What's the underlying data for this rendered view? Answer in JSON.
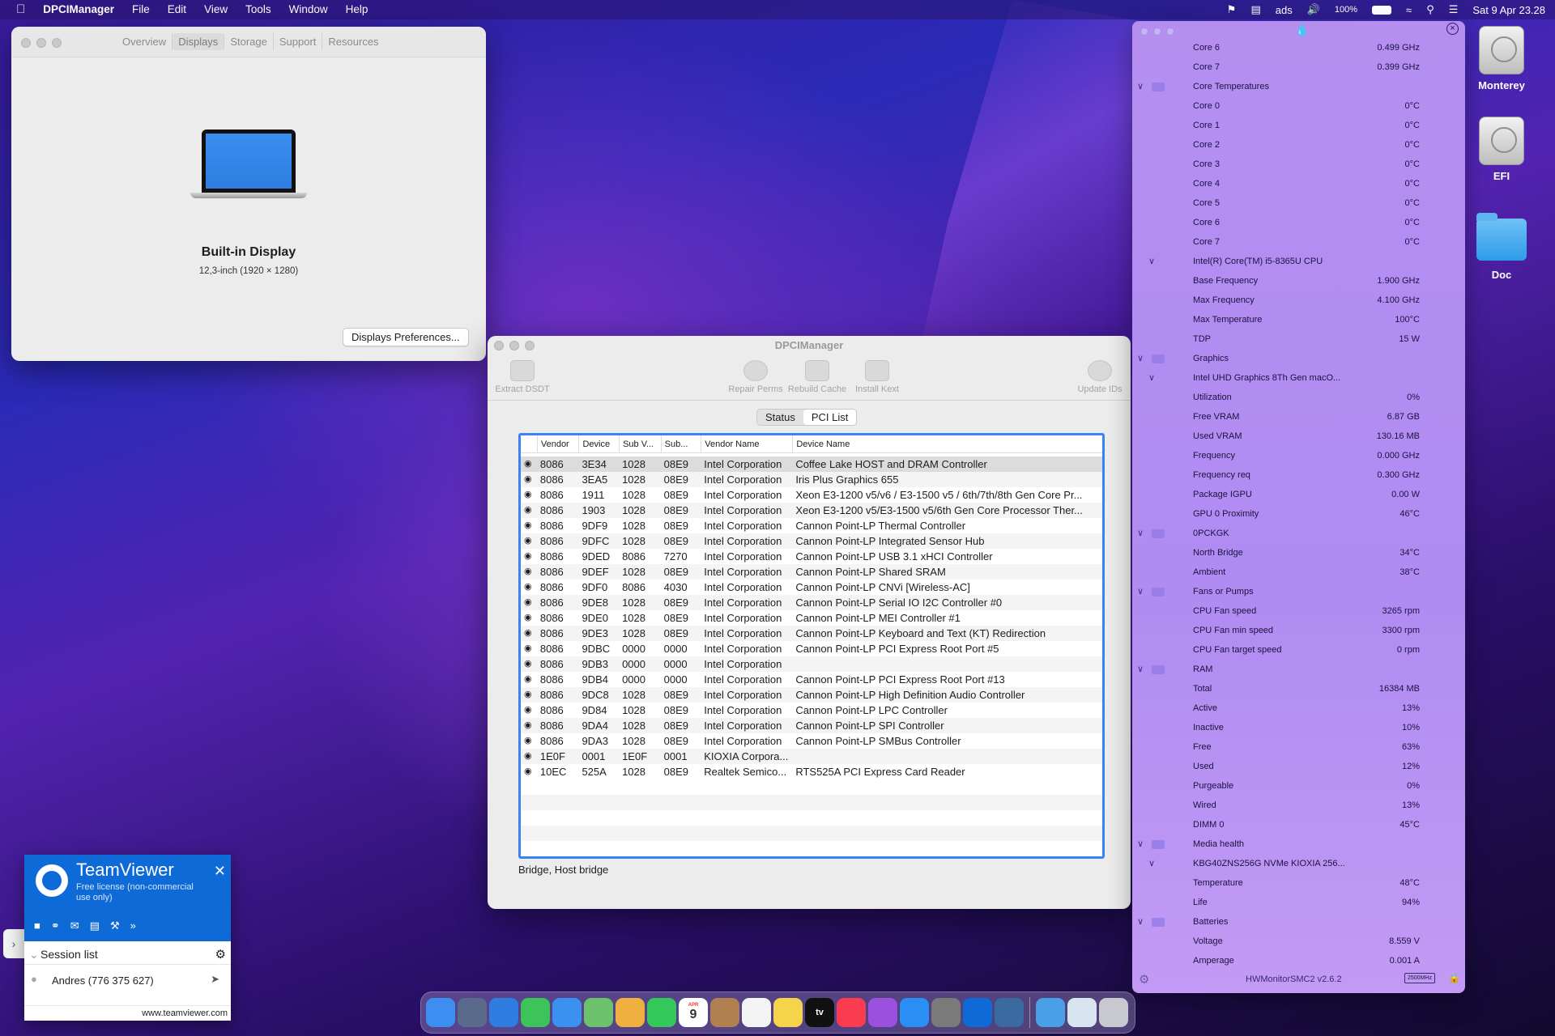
{
  "menubar": {
    "app": "DPCIManager",
    "items": [
      "File",
      "Edit",
      "View",
      "Tools",
      "Window",
      "Help"
    ],
    "status": [
      "ads",
      "100%",
      "Sat 9 Apr  23.28"
    ]
  },
  "about": {
    "tabs": [
      "Overview",
      "Displays",
      "Storage",
      "Support",
      "Resources"
    ],
    "active_tab": "Displays",
    "display_name": "Built-in Display",
    "display_spec": "12,3-inch (1920 × 1280)",
    "prefs_button": "Displays Preferences..."
  },
  "dpci": {
    "title": "DPCIManager",
    "toolbar": [
      "Extract DSDT",
      "Repair Perms",
      "Rebuild Cache",
      "Install Kext",
      "Update IDs"
    ],
    "tabs": [
      "Status",
      "PCI List"
    ],
    "active_tab": "PCI List",
    "columns": [
      "Vendor",
      "Device",
      "Sub V...",
      "Sub...",
      "Vendor Name",
      "Device Name"
    ],
    "rows": [
      [
        "8086",
        "3E34",
        "1028",
        "08E9",
        "Intel Corporation",
        "Coffee Lake HOST and DRAM Controller"
      ],
      [
        "8086",
        "3EA5",
        "1028",
        "08E9",
        "Intel Corporation",
        "Iris Plus Graphics 655"
      ],
      [
        "8086",
        "1911",
        "1028",
        "08E9",
        "Intel Corporation",
        "Xeon E3-1200 v5/v6 / E3-1500 v5 / 6th/7th/8th Gen Core Pr..."
      ],
      [
        "8086",
        "1903",
        "1028",
        "08E9",
        "Intel Corporation",
        "Xeon E3-1200 v5/E3-1500 v5/6th Gen Core Processor Ther..."
      ],
      [
        "8086",
        "9DF9",
        "1028",
        "08E9",
        "Intel Corporation",
        "Cannon Point-LP Thermal Controller"
      ],
      [
        "8086",
        "9DFC",
        "1028",
        "08E9",
        "Intel Corporation",
        "Cannon Point-LP Integrated Sensor Hub"
      ],
      [
        "8086",
        "9DED",
        "8086",
        "7270",
        "Intel Corporation",
        "Cannon Point-LP USB 3.1 xHCI Controller"
      ],
      [
        "8086",
        "9DEF",
        "1028",
        "08E9",
        "Intel Corporation",
        "Cannon Point-LP Shared SRAM"
      ],
      [
        "8086",
        "9DF0",
        "8086",
        "4030",
        "Intel Corporation",
        "Cannon Point-LP CNVi [Wireless-AC]"
      ],
      [
        "8086",
        "9DE8",
        "1028",
        "08E9",
        "Intel Corporation",
        "Cannon Point-LP Serial IO I2C Controller #0"
      ],
      [
        "8086",
        "9DE0",
        "1028",
        "08E9",
        "Intel Corporation",
        "Cannon Point-LP MEI Controller #1"
      ],
      [
        "8086",
        "9DE3",
        "1028",
        "08E9",
        "Intel Corporation",
        "Cannon Point-LP Keyboard and Text (KT) Redirection"
      ],
      [
        "8086",
        "9DBC",
        "0000",
        "0000",
        "Intel Corporation",
        "Cannon Point-LP PCI Express Root Port #5"
      ],
      [
        "8086",
        "9DB3",
        "0000",
        "0000",
        "Intel Corporation",
        ""
      ],
      [
        "8086",
        "9DB4",
        "0000",
        "0000",
        "Intel Corporation",
        "Cannon Point-LP PCI Express Root Port #13"
      ],
      [
        "8086",
        "9DC8",
        "1028",
        "08E9",
        "Intel Corporation",
        "Cannon Point-LP High Definition Audio Controller"
      ],
      [
        "8086",
        "9D84",
        "1028",
        "08E9",
        "Intel Corporation",
        "Cannon Point-LP LPC Controller"
      ],
      [
        "8086",
        "9DA4",
        "1028",
        "08E9",
        "Intel Corporation",
        "Cannon Point-LP SPI Controller"
      ],
      [
        "8086",
        "9DA3",
        "1028",
        "08E9",
        "Intel Corporation",
        "Cannon Point-LP SMBus Controller"
      ],
      [
        "1E0F",
        "0001",
        "1E0F",
        "0001",
        "KIOXIA Corpora...",
        ""
      ],
      [
        "10EC",
        "525A",
        "1028",
        "08E9",
        "Realtek Semico...",
        "RTS525A PCI Express Card Reader"
      ]
    ],
    "status_text": "Bridge, Host bridge"
  },
  "hwmonitor": {
    "footer": "HWMonitorSMC2 v2.6.2",
    "footer_badge": "2500MHz",
    "rows": [
      {
        "l": "Core 6",
        "v": "0.499 GHz"
      },
      {
        "l": "Core 7",
        "v": "0.399 GHz"
      },
      {
        "l": "Core Temperatures",
        "v": "",
        "h": 1
      },
      {
        "l": "Core 0",
        "v": "0°C"
      },
      {
        "l": "Core 1",
        "v": "0°C"
      },
      {
        "l": "Core 2",
        "v": "0°C"
      },
      {
        "l": "Core 3",
        "v": "0°C"
      },
      {
        "l": "Core 4",
        "v": "0°C"
      },
      {
        "l": "Core 5",
        "v": "0°C"
      },
      {
        "l": "Core 6",
        "v": "0°C"
      },
      {
        "l": "Core 7",
        "v": "0°C"
      },
      {
        "l": "Intel(R) Core(TM) i5-8365U CPU",
        "v": "",
        "h": 2
      },
      {
        "l": "Base Frequency",
        "v": "1.900 GHz"
      },
      {
        "l": "Max Frequency",
        "v": "4.100 GHz"
      },
      {
        "l": "Max Temperature",
        "v": "100°C"
      },
      {
        "l": "TDP",
        "v": "15 W"
      },
      {
        "l": "Graphics",
        "v": "",
        "h": 1
      },
      {
        "l": "Intel UHD Graphics 8Th Gen macO...",
        "v": "",
        "h": 2
      },
      {
        "l": "Utilization",
        "v": "0%"
      },
      {
        "l": "Free VRAM",
        "v": "6.87 GB"
      },
      {
        "l": "Used VRAM",
        "v": "130.16 MB"
      },
      {
        "l": "Frequency",
        "v": "0.000 GHz"
      },
      {
        "l": "Frequency req",
        "v": "0.300 GHz"
      },
      {
        "l": "Package IGPU",
        "v": "0.00 W"
      },
      {
        "l": "GPU 0 Proximity",
        "v": "46°C"
      },
      {
        "l": "0PCKGK",
        "v": "",
        "h": 1
      },
      {
        "l": "North Bridge",
        "v": "34°C"
      },
      {
        "l": "Ambient",
        "v": "38°C"
      },
      {
        "l": "Fans or Pumps",
        "v": "",
        "h": 1
      },
      {
        "l": "CPU Fan speed",
        "v": "3265 rpm"
      },
      {
        "l": "CPU Fan min speed",
        "v": "3300 rpm"
      },
      {
        "l": "CPU Fan target speed",
        "v": "0 rpm"
      },
      {
        "l": "RAM",
        "v": "",
        "h": 1
      },
      {
        "l": "Total",
        "v": "16384 MB"
      },
      {
        "l": "Active",
        "v": "13%"
      },
      {
        "l": "Inactive",
        "v": "10%"
      },
      {
        "l": "Free",
        "v": "63%"
      },
      {
        "l": "Used",
        "v": "12%"
      },
      {
        "l": "Purgeable",
        "v": "0%"
      },
      {
        "l": "Wired",
        "v": "13%"
      },
      {
        "l": "DIMM 0",
        "v": "45°C"
      },
      {
        "l": "Media health",
        "v": "",
        "h": 1
      },
      {
        "l": "KBG40ZNS256G NVMe KIOXIA 256...",
        "v": "",
        "h": 2
      },
      {
        "l": "Temperature",
        "v": "48°C"
      },
      {
        "l": "Life",
        "v": "94%"
      },
      {
        "l": "Batteries",
        "v": "",
        "h": 1
      },
      {
        "l": "Voltage",
        "v": "8.559 V"
      },
      {
        "l": "Amperage",
        "v": "0.001 A"
      }
    ]
  },
  "desktop": {
    "icons": [
      "Monterey",
      "EFI",
      "Doc"
    ]
  },
  "teamviewer": {
    "title": "TeamViewer",
    "subtitle": "Free license (non-commercial use only)",
    "session_list": "Session list",
    "contact": "Andres (776 375 627)",
    "url": "www.teamviewer.com"
  },
  "dock": {
    "items": [
      "finder-icon",
      "launchpad-icon",
      "safari-icon",
      "messages-icon",
      "mail-icon",
      "maps-icon",
      "photos-icon",
      "facetime-icon",
      "calendar-icon",
      "contacts-icon",
      "reminders-icon",
      "notes-icon",
      "tv-icon",
      "music-icon",
      "podcasts-icon",
      "appstore-icon",
      "settings-icon",
      "teamviewer-icon",
      "dpci-icon",
      "downloads-icon",
      "preview-icon",
      "trash-icon"
    ],
    "calendar_day": "9",
    "calendar_month": "APR",
    "tv_label": "tv"
  }
}
